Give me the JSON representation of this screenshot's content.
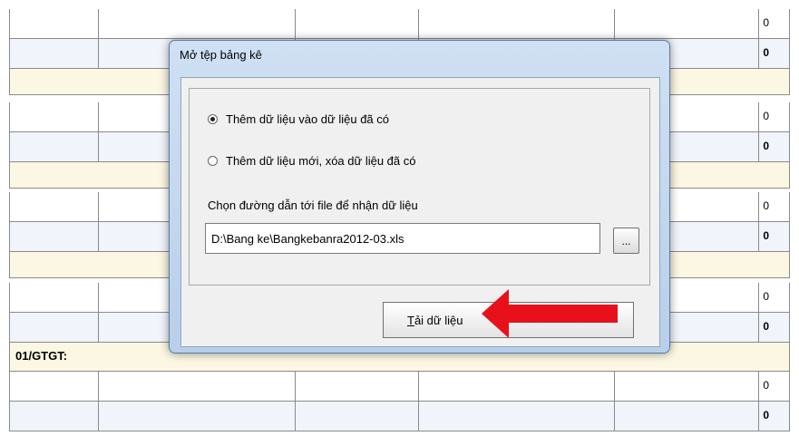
{
  "table": {
    "values": [
      "0",
      "0",
      "0",
      "0",
      "0",
      "0",
      "0",
      "0",
      "0",
      "0"
    ],
    "section_label": "01/GTGT:"
  },
  "dialog": {
    "title": "Mở tệp bảng kê",
    "option_append": "Thêm dữ liệu vào dữ liệu đã có",
    "option_replace": "Thêm dữ liệu mới, xóa dữ liệu đã có",
    "selected_option": "append",
    "path_label": "Chọn đường dẫn tới file để nhận dữ liệu",
    "path_value": "D:\\Bang ke\\Bangkebanra2012-03.xls",
    "browse_label": "...",
    "load_button_accel": "T",
    "load_button_rest": "ải dữ liệu"
  },
  "annotation": {
    "arrow_color": "#e8101a"
  }
}
